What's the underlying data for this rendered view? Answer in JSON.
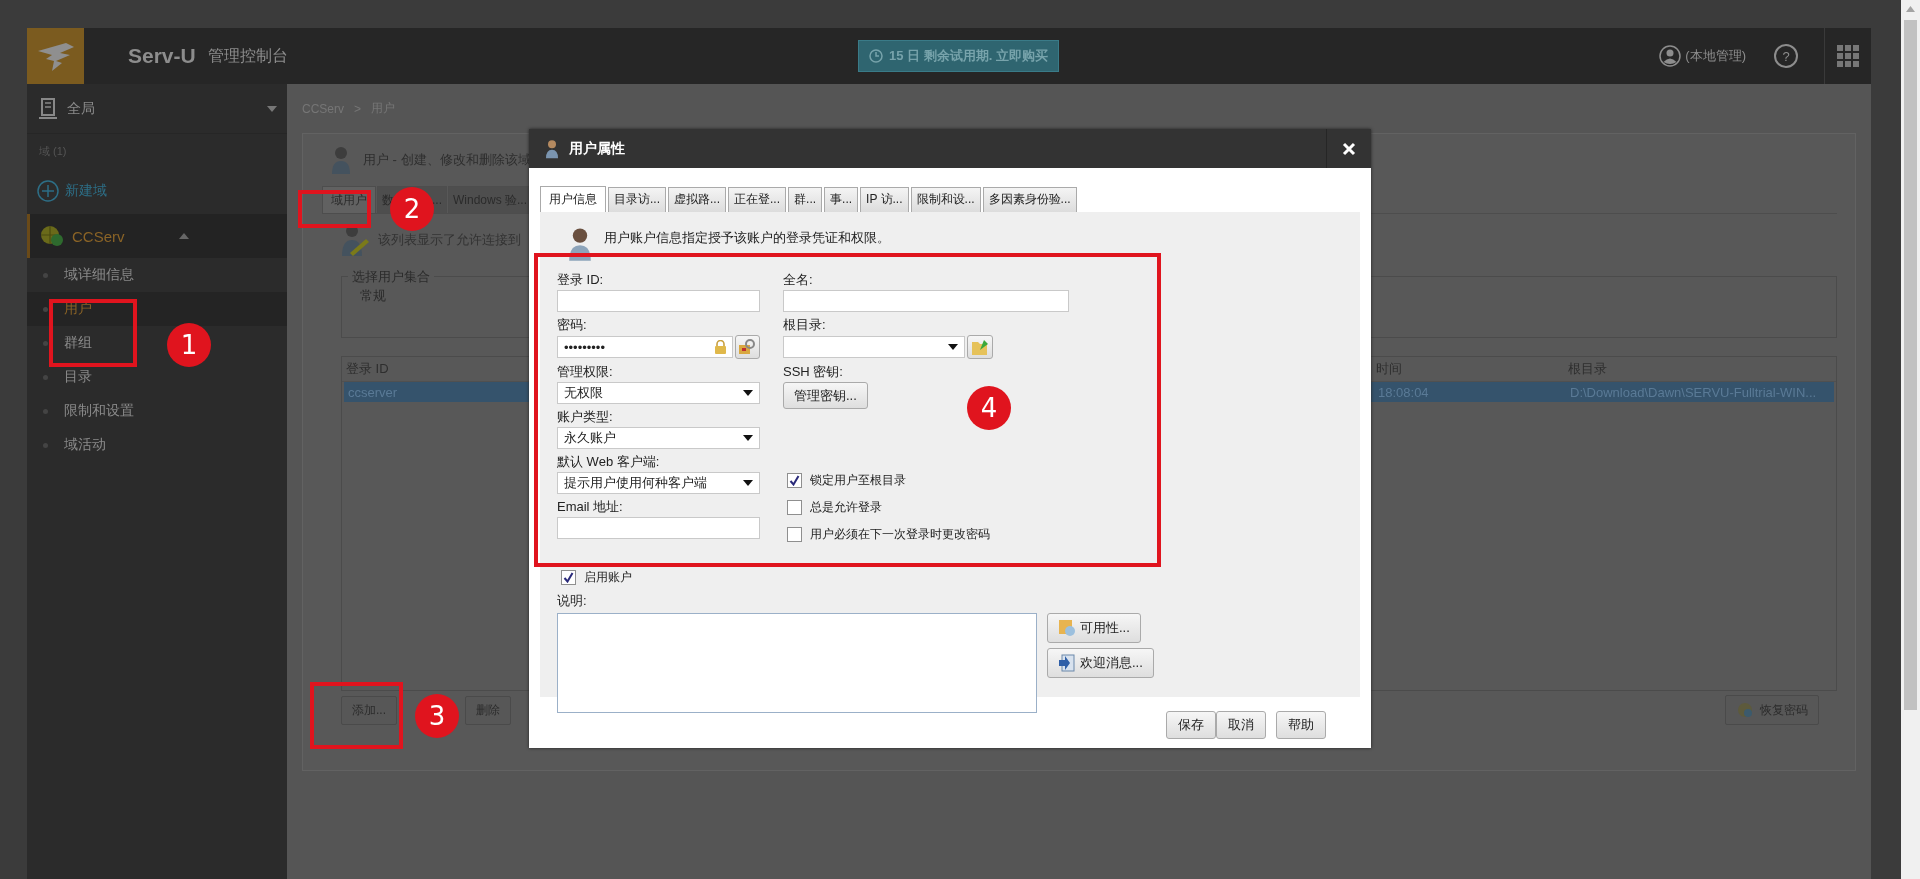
{
  "header": {
    "logo_title": "Serv-U",
    "subtitle": "管理控制台",
    "trial_badge": "15 日 剩余试用期. 立即购买",
    "user": "(本地管理)",
    "help": "?"
  },
  "sidebar": {
    "scope": "全局",
    "domain_count": "域 (1)",
    "new_domain": "新建域",
    "domain": {
      "name": "CCServ",
      "expanded": true,
      "items": [
        {
          "label": "域详细信息",
          "selected": false
        },
        {
          "label": "用户",
          "selected": true
        },
        {
          "label": "群组",
          "selected": false
        },
        {
          "label": "目录",
          "selected": false
        },
        {
          "label": "限制和设置",
          "selected": false
        },
        {
          "label": "域活动",
          "selected": false
        }
      ]
    }
  },
  "content": {
    "breadcrumb": [
      "CCServ",
      ">",
      "用户"
    ],
    "heading": "用户 - 创建、修改和删除该域",
    "tabs": [
      {
        "label": "域用户",
        "selected": true
      },
      {
        "label": "数",
        "label_end": "...",
        "selected": false
      },
      {
        "label": "Windows 验...",
        "selected": false
      }
    ],
    "description": "该列表显示了允许连接到",
    "user_set": {
      "legend": "选择用户集合",
      "items": [
        "常规"
      ]
    },
    "table": {
      "columns": [
        "登录 ID",
        "时间",
        "根目录"
      ],
      "rows": [
        {
          "cells": [
            "ccserver",
            "18:08:04",
            "D:\\Download\\Dawn\\SERVU-Fulltrial-WIN..."
          ],
          "selected": true
        }
      ]
    },
    "buttons": [
      "添加...",
      "删除"
    ],
    "recover_button": "恢复密码"
  },
  "dialog": {
    "title": "用户属性",
    "tabs": [
      {
        "label": "用户信息",
        "selected": true
      },
      {
        "label": "目录访...",
        "selected": false
      },
      {
        "label": "虚拟路...",
        "selected": false
      },
      {
        "label": "正在登...",
        "selected": false
      },
      {
        "label": "群...",
        "selected": false
      },
      {
        "label": "事...",
        "selected": false
      },
      {
        "label": "IP 访...",
        "selected": false
      },
      {
        "label": "限制和设...",
        "selected": false
      },
      {
        "label": "多因素身份验...",
        "selected": false
      }
    ],
    "intro": "用户账户信息指定授予该账户的登录凭证和权限。",
    "left_fields": [
      {
        "kind": "input",
        "label": "登录 ID:"
      },
      {
        "kind": "password",
        "label": "密码:",
        "value": "•••••••••"
      },
      {
        "kind": "select",
        "label": "管理权限:",
        "value": "无权限"
      },
      {
        "kind": "select",
        "label": "账户类型:",
        "value": "永久账户"
      },
      {
        "kind": "select",
        "label": "默认 Web 客户端:",
        "value": "提示用户使用何种客户端"
      },
      {
        "kind": "input",
        "label": "Email 地址:"
      }
    ],
    "right_fields": [
      {
        "kind": "input",
        "label": "全名:"
      },
      {
        "kind": "folder-select",
        "label": "根目录:"
      },
      {
        "kind": "button",
        "label": "SSH 密钥:",
        "value": "管理密钥..."
      }
    ],
    "options": [
      {
        "label": "锁定用户至根目录",
        "checked": true
      },
      {
        "label": "总是允许登录",
        "checked": false
      },
      {
        "label": "用户必须在下一次登录时更改密码",
        "checked": false
      }
    ],
    "enable_account": {
      "label": "启用账户",
      "checked": true
    },
    "notes_label": "说明:",
    "side_buttons": [
      {
        "label": "可用性...",
        "kind": "availability"
      },
      {
        "label": "欢迎消息...",
        "kind": "welcome"
      }
    ],
    "footer_buttons": [
      "保存",
      "取消",
      "帮助"
    ]
  },
  "annotations": [
    {
      "number": "1"
    },
    {
      "number": "2"
    },
    {
      "number": "3"
    },
    {
      "number": "4"
    }
  ]
}
